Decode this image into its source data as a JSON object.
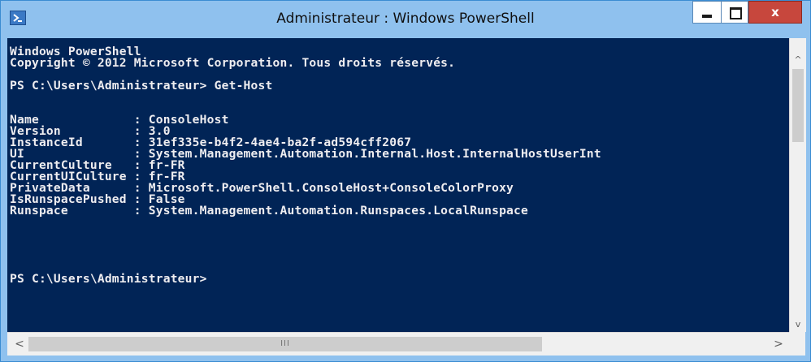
{
  "window": {
    "title": "Administrateur : Windows PowerShell",
    "icon": "powershell-icon",
    "controls": {
      "minimize_icon": "minimize-icon",
      "maximize_icon": "maximize-icon",
      "close_label": "x"
    },
    "accent": "#8fc1ee",
    "console_bg": "#012456",
    "console_fg": "#eeedf0",
    "close_color": "#c7473d"
  },
  "console": {
    "lines": [
      "Windows PowerShell",
      "Copyright © 2012 Microsoft Corporation. Tous droits réservés.",
      "",
      "PS C:\\Users\\Administrateur> Get-Host",
      "",
      "",
      "Name             : ConsoleHost",
      "Version          : 3.0",
      "InstanceId       : 31ef335e-b4f2-4ae4-ba2f-ad594cff2067",
      "UI               : System.Management.Automation.Internal.Host.InternalHostUserInt",
      "CurrentCulture   : fr-FR",
      "CurrentUICulture : fr-FR",
      "PrivateData      : Microsoft.PowerShell.ConsoleHost+ConsoleColorProxy",
      "IsRunspacePushed : False",
      "Runspace         : System.Management.Automation.Runspaces.LocalRunspace",
      "",
      "",
      "",
      "",
      "",
      "PS C:\\Users\\Administrateur>"
    ]
  },
  "scrollbars": {
    "vertical_up": "^",
    "vertical_down": "v",
    "horizontal_left": "<",
    "horizontal_right": ">",
    "horizontal_grip": "III"
  }
}
